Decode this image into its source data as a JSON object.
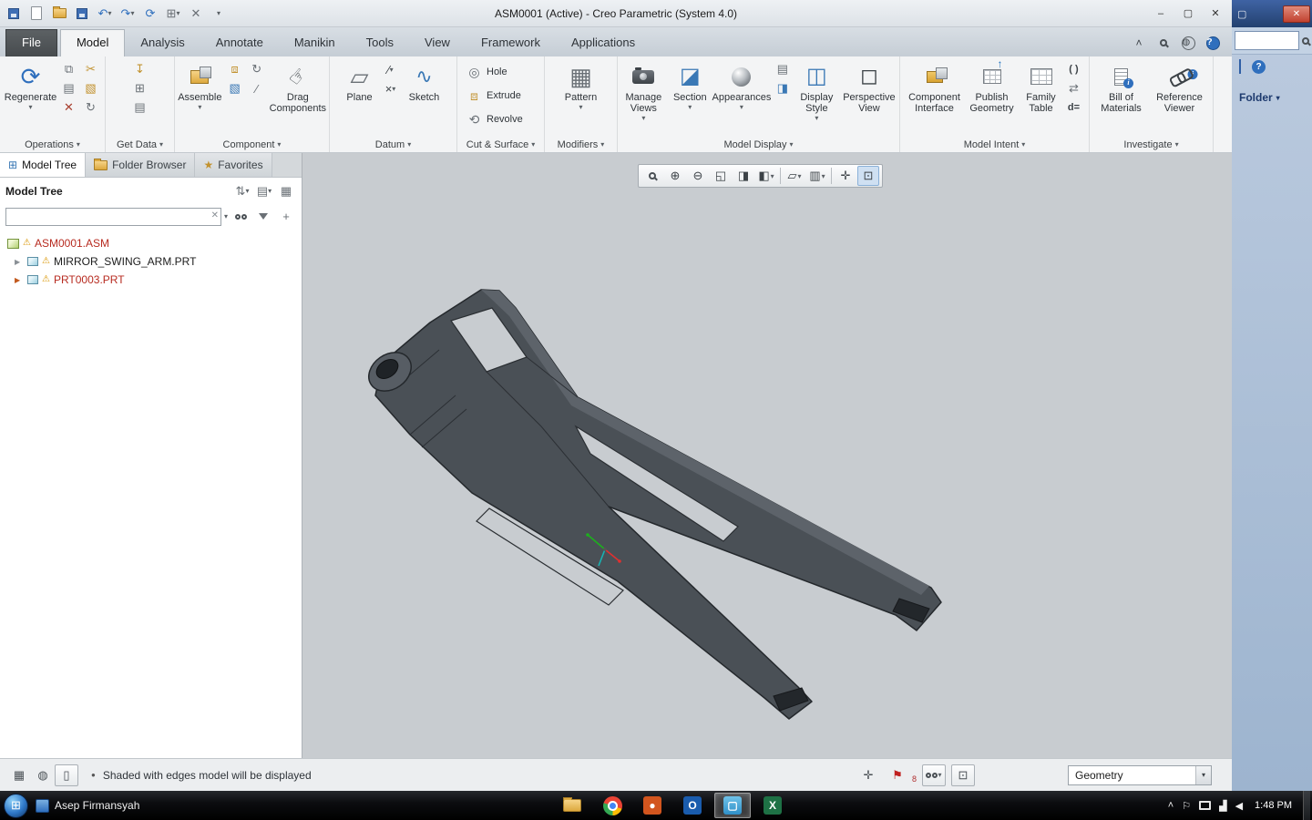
{
  "titlebar": {
    "title": "ASM0001 (Active) - Creo Parametric (System 4.0)"
  },
  "tabs": [
    "File",
    "Model",
    "Analysis",
    "Annotate",
    "Manikin",
    "Tools",
    "View",
    "Framework",
    "Applications"
  ],
  "active_tab": "Model",
  "ribbon": {
    "group_labels": [
      "Operations",
      "Get Data",
      "Component",
      "Datum",
      "Cut & Surface",
      "Modifiers",
      "Model Display",
      "Model Intent",
      "Investigate"
    ],
    "buttons": {
      "regenerate": "Regenerate",
      "assemble": "Assemble",
      "drag_components": "Drag Components",
      "plane": "Plane",
      "sketch": "Sketch",
      "hole": "Hole",
      "extrude": "Extrude",
      "revolve": "Revolve",
      "pattern": "Pattern",
      "manage_views": "Manage Views",
      "section": "Section",
      "appearances": "Appearances",
      "display_style": "Display Style",
      "perspective_view": "Perspective View",
      "component_interface": "Component Interface",
      "publish_geometry": "Publish Geometry",
      "family_table": "Family Table",
      "parens": "( )",
      "d_equals": "d=",
      "bill_of_materials": "Bill of Materials",
      "reference_viewer": "Reference Viewer"
    }
  },
  "model_tree": {
    "tabs": [
      "Model Tree",
      "Folder Browser",
      "Favorites"
    ],
    "header": "Model Tree",
    "search_value": "",
    "items": [
      {
        "label": "ASM0001.ASM",
        "type": "assembly",
        "warning": true,
        "style": "color:#b72b20"
      },
      {
        "label": "MIRROR_SWING_ARM.PRT",
        "type": "part",
        "warning": true,
        "style": "color:#1c1c1c"
      },
      {
        "label": "PRT0003.PRT",
        "type": "part",
        "warning": true,
        "style": "color:#b72b20"
      }
    ]
  },
  "status_bar": {
    "message": "Shaded with edges model will be displayed",
    "flag_count": "8",
    "filter_label": "Geometry"
  },
  "side_window": {
    "folder_label": "Folder"
  },
  "taskbar": {
    "username": "Asep Firmansyah",
    "time": "1:48 PM"
  },
  "colors": {
    "model_fill": "#4a5056",
    "model_edge": "#24282c",
    "graphics_bg": "#c8ccd0",
    "warning_red": "#b72b20",
    "side_window_blue": "#2f5fa5",
    "accent_blue": "#2f6fbd"
  },
  "icons": {
    "dropdown-arrow": "▾",
    "undo": "↶",
    "redo": "↷",
    "regenerate": "⟳",
    "minimize": "–",
    "maximize": "▢",
    "close": "✕",
    "copy": "⧉",
    "paste": "▤",
    "delete": "✕",
    "cut": "✂",
    "mirror": "▧",
    "repeat": "↻",
    "import": "↧",
    "grid-plus": "⊞",
    "rows": "▤",
    "hand": "☞",
    "plane": "▱",
    "axis": "∕",
    "point": "×",
    "sketch": "∿",
    "hole": "◎",
    "extrude": "⧈",
    "revolve": "⟲",
    "pattern": "▦",
    "section": "◪",
    "display-style": "◫",
    "small-style": "◨",
    "perspective": "◻",
    "up-arrow": "↑",
    "info": "i",
    "chevron-up": "˄",
    "question": "?",
    "warning": "⚠",
    "tree-arrow": "▶",
    "star": "★",
    "sort": "⇅",
    "grid": "▦",
    "plus": "+",
    "clear": "✕",
    "zoom-in": "⊕",
    "zoom-out": "⊖",
    "refit": "◱",
    "repaint": "◨",
    "shade": "◧",
    "hatch": "▥",
    "datum-display": "▱",
    "spin-center": "✛",
    "view-manager": "⊡",
    "globe": "◍",
    "page": "▯",
    "axes": "✛",
    "flag": "⚑",
    "bullet": "●",
    "switch": "⇄",
    "pencil": "✎",
    "outlook": "O",
    "excel": "X",
    "net": "▟",
    "volume": "◀",
    "tray-flag": "⚐"
  }
}
